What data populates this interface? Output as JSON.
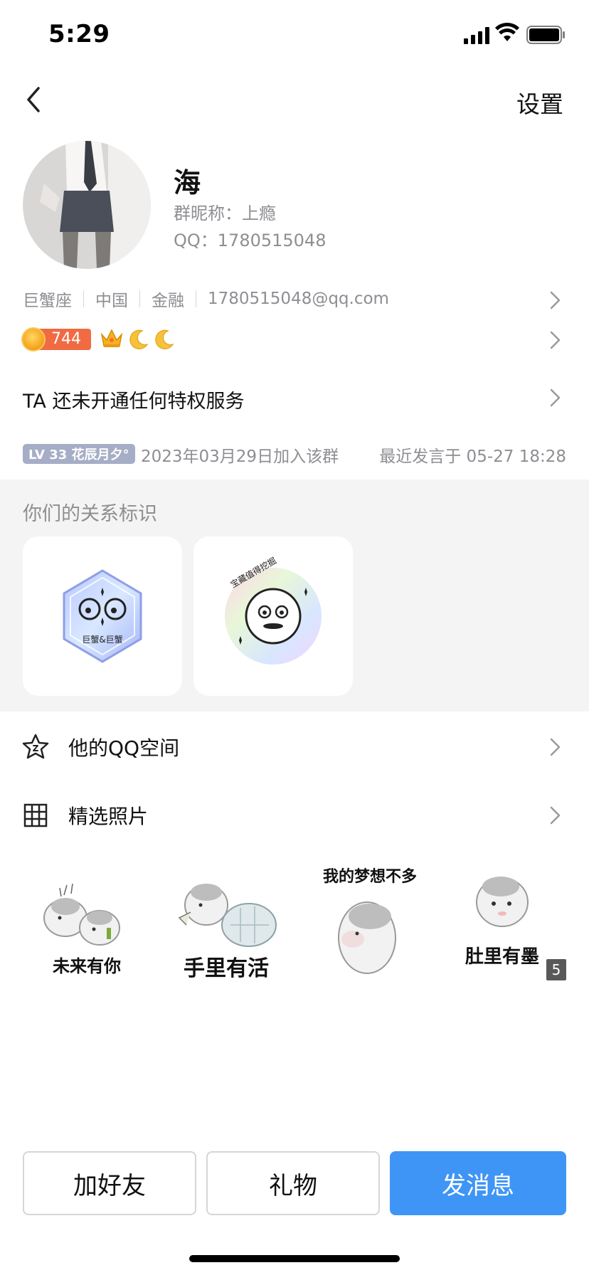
{
  "status_bar": {
    "time": "5:29"
  },
  "nav": {
    "settings_label": "设置"
  },
  "profile": {
    "name": "海",
    "group_nickname": "群昵称：上瘾",
    "qq": "QQ：1780515048"
  },
  "info": {
    "zodiac": "巨蟹座",
    "country": "中国",
    "industry": "金融",
    "email": "1780515048@qq.com"
  },
  "badges": {
    "coin_value": "744",
    "icons": [
      "crown-icon",
      "moon-icon",
      "moon-icon"
    ]
  },
  "privilege": {
    "text": "TA 还未开通任何特权服务"
  },
  "level": {
    "badge": "LV 33 花辰月夕°",
    "join_date": "2023年03月29日加入该群",
    "last_speak": "最近发言于 05-27 18:28"
  },
  "relation": {
    "title": "你们的关系标识",
    "cards": [
      {
        "label": "巨蟹&巨蟹"
      },
      {
        "label": "宝藏值得挖掘"
      }
    ]
  },
  "rows": {
    "qzone_label": "他的QQ空间",
    "photos_label": "精选照片"
  },
  "photos": {
    "items": [
      {
        "caption": "未来有你"
      },
      {
        "caption": "手里有活"
      },
      {
        "caption": "我的梦想不多"
      },
      {
        "caption": "肚里有墨"
      }
    ],
    "count": "5"
  },
  "actions": {
    "add_friend": "加好友",
    "gift": "礼物",
    "send_message": "发消息"
  },
  "colors": {
    "primary_blue": "#3f95f5",
    "coin_orange": "#f06a43",
    "secondary_text": "#8e8e93",
    "section_bg": "#f4f4f4"
  }
}
